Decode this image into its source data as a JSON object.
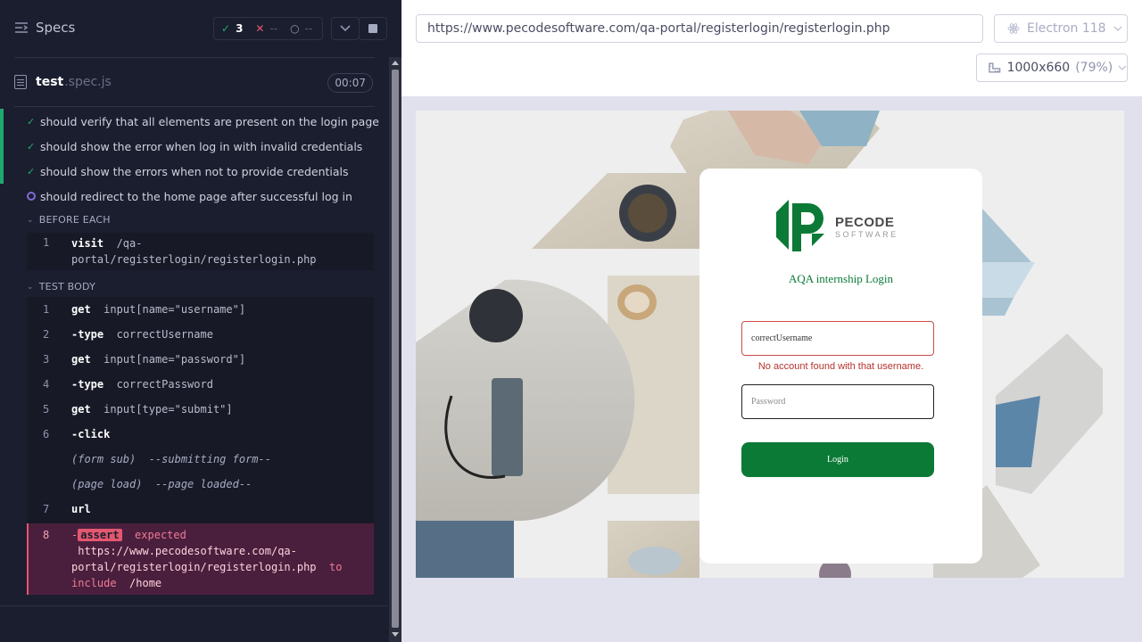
{
  "reporter": {
    "specs_label": "Specs",
    "stats": {
      "passed": "3",
      "failed": "--",
      "pending": "--"
    },
    "file": {
      "name": "test",
      "ext": ".spec.js",
      "duration": "00:07"
    },
    "tests": [
      {
        "title": "should verify that all elements are present on the login page",
        "state": "passed"
      },
      {
        "title": "should show the error when log in with invalid credentials",
        "state": "passed"
      },
      {
        "title": "should show the errors when not to provide credentials",
        "state": "passed"
      },
      {
        "title": "should redirect to the home page after successful log in",
        "state": "running"
      }
    ],
    "before_each": {
      "label": "BEFORE EACH",
      "commands": [
        {
          "n": "1",
          "name": "visit",
          "line1": "/qa-",
          "line2": "portal/registerlogin/registerlogin.php"
        }
      ]
    },
    "test_body": {
      "label": "TEST BODY",
      "commands": [
        {
          "n": "1",
          "name": "get",
          "arg": "input[name=\"username\"]"
        },
        {
          "n": "2",
          "name": "-type",
          "arg": "correctUsername"
        },
        {
          "n": "3",
          "name": "get",
          "arg": "input[name=\"password\"]"
        },
        {
          "n": "4",
          "name": "-type",
          "arg": "correctPassword"
        },
        {
          "n": "5",
          "name": "get",
          "arg": "input[type=\"submit\"]"
        },
        {
          "n": "6",
          "name": "-click",
          "arg": ""
        },
        {
          "n": "",
          "name": "(form sub)",
          "arg": "--submitting form--"
        },
        {
          "n": "",
          "name": "(page load)",
          "arg": "--page loaded--"
        },
        {
          "n": "7",
          "name": "url",
          "arg": ""
        }
      ],
      "assert": {
        "n": "8",
        "dash": "-",
        "badge": "assert",
        "expected": "expected",
        "url_line1": "https://www.pecodesoftware.com/qa-",
        "url_line2": "portal/registerlogin/registerlogin.php",
        "to": "to",
        "include": "include",
        "target": "/home"
      }
    }
  },
  "aut": {
    "url": "https://www.pecodesoftware.com/qa-portal/registerlogin/registerlogin.php",
    "browser": "Electron 118",
    "viewport": "1000x660",
    "scale": "(79%)",
    "login": {
      "logo_word": "PECODE",
      "logo_sub": "SOFTWARE",
      "title": "AQA internship Login",
      "username_value": "correctUsername",
      "error": "No account found with that username.",
      "password_placeholder": "Password",
      "button": "Login"
    }
  },
  "colors": {
    "reporter_bg": "#1b1e2e",
    "pass_green": "#1fa971",
    "fail_red": "#e45770",
    "brand_green": "#0b7a36"
  }
}
